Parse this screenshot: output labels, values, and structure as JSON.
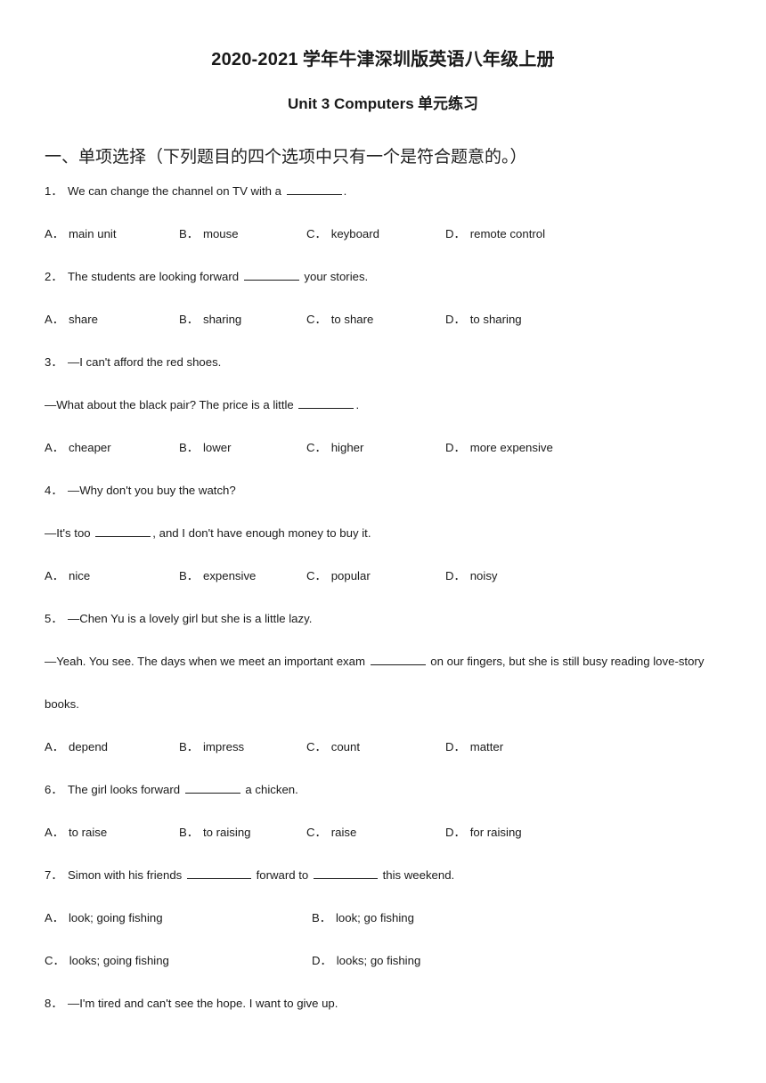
{
  "document": {
    "title_latin": "2020-2021",
    "title_cn": "学年牛津深圳版英语八年级上册",
    "subtitle_latin": "Unit 3 Computers",
    "subtitle_cn": "单元练习"
  },
  "sections": [
    {
      "heading": "一、单项选择（下列题目的四个选项中只有一个是符合题意的。）"
    }
  ],
  "questions": [
    {
      "number": "1．",
      "stem_parts": [
        "We can change the channel on TV with a ",
        "."
      ],
      "options_layout": "4col",
      "options": [
        {
          "key": "A．",
          "text": "main unit"
        },
        {
          "key": "B．",
          "text": "mouse"
        },
        {
          "key": "C．",
          "text": "keyboard"
        },
        {
          "key": "D．",
          "text": "remote control"
        }
      ]
    },
    {
      "number": "2．",
      "stem_parts": [
        "The students are looking forward ",
        " your stories."
      ],
      "options_layout": "4col",
      "options": [
        {
          "key": "A．",
          "text": "share"
        },
        {
          "key": "B．",
          "text": "sharing"
        },
        {
          "key": "C．",
          "text": "to share"
        },
        {
          "key": "D．",
          "text": "to sharing"
        }
      ]
    },
    {
      "number": "3．",
      "stem_line1": "—I can't afford the red shoes.",
      "stem_line2_parts": [
        "—What about the black pair? The price is a little ",
        "."
      ],
      "options_layout": "4col",
      "options": [
        {
          "key": "A．",
          "text": "cheaper"
        },
        {
          "key": "B．",
          "text": "lower"
        },
        {
          "key": "C．",
          "text": "higher"
        },
        {
          "key": "D．",
          "text": "more expensive"
        }
      ]
    },
    {
      "number": "4．",
      "stem_line1": "—Why don't you buy the watch?",
      "stem_line2_parts": [
        "—It's too ",
        ", and I don't have enough money to buy it."
      ],
      "options_layout": "4col",
      "options": [
        {
          "key": "A．",
          "text": "nice"
        },
        {
          "key": "B．",
          "text": "expensive"
        },
        {
          "key": "C．",
          "text": "popular"
        },
        {
          "key": "D．",
          "text": "noisy"
        }
      ]
    },
    {
      "number": "5．",
      "stem_line1": "—Chen Yu is a lovely girl but she is a little lazy.",
      "stem_line2_parts": [
        "—Yeah. You see. The days when we meet an important exam ",
        " on our fingers, but she is still busy reading love-story books."
      ],
      "options_layout": "4col",
      "options": [
        {
          "key": "A．",
          "text": "depend"
        },
        {
          "key": "B．",
          "text": "impress"
        },
        {
          "key": "C．",
          "text": "count"
        },
        {
          "key": "D．",
          "text": "matter"
        }
      ]
    },
    {
      "number": "6．",
      "stem_parts": [
        "The girl looks forward ",
        " a chicken."
      ],
      "options_layout": "4col",
      "options": [
        {
          "key": "A．",
          "text": "to raise"
        },
        {
          "key": "B．",
          "text": "to raising"
        },
        {
          "key": "C．",
          "text": "raise"
        },
        {
          "key": "D．",
          "text": "for raising"
        }
      ]
    },
    {
      "number": "7．",
      "stem_parts": [
        "Simon with his friends ",
        " forward to ",
        " this weekend."
      ],
      "options_layout": "2col",
      "options": [
        {
          "key": "A．",
          "text": "look; going fishing"
        },
        {
          "key": "B．",
          "text": "look; go fishing"
        },
        {
          "key": "C．",
          "text": "looks; going fishing"
        },
        {
          "key": "D．",
          "text": "looks; go fishing"
        }
      ]
    },
    {
      "number": "8．",
      "stem_line1": "—I'm tired and can't see the hope. I want to give up.",
      "options_layout": "none",
      "options": []
    }
  ]
}
